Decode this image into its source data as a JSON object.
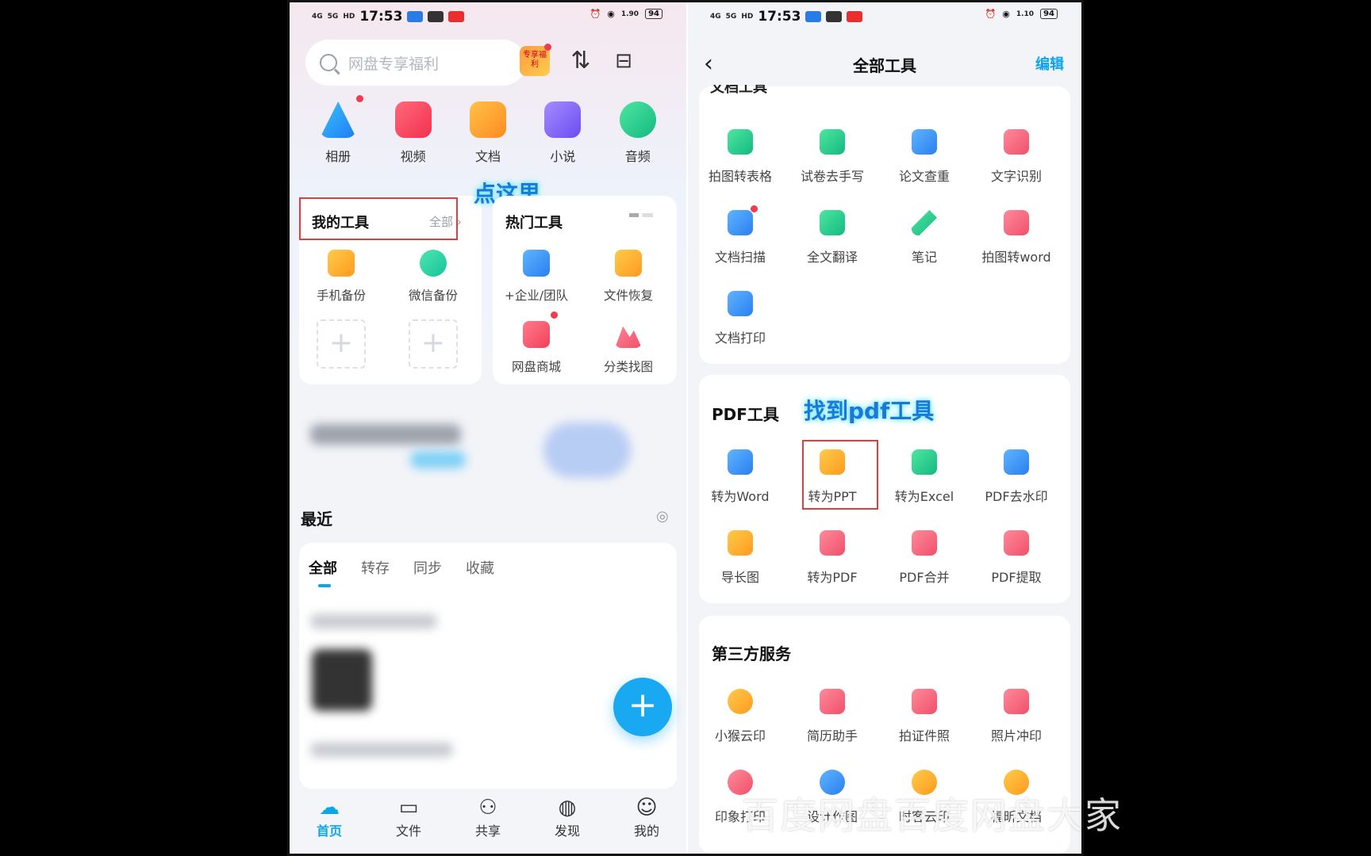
{
  "status_bar": {
    "time": "17:53",
    "net_left": "4G",
    "net_5g": "5G",
    "hd": "HD",
    "speed_left": "1.90",
    "speed_right": "1.10",
    "battery": "94"
  },
  "left": {
    "search_placeholder": "网盘专享福利",
    "gift_text": "专享福利",
    "categories": [
      "相册",
      "视频",
      "文档",
      "小说",
      "音频"
    ],
    "my_tools": {
      "title": "我的工具",
      "all": "全部",
      "items": [
        "手机备份",
        "微信备份"
      ],
      "add": "+"
    },
    "hot_tools": {
      "title": "热门工具",
      "items": [
        "+企业/团队",
        "文件恢复",
        "网盘商城",
        "分类找图"
      ]
    },
    "annotation": "点这里",
    "recent": {
      "title": "最近",
      "tabs": [
        "全部",
        "转存",
        "同步",
        "收藏"
      ]
    },
    "fab": "+",
    "nav": [
      "首页",
      "文件",
      "共享",
      "发现",
      "我的"
    ],
    "watermark": "百度网盘百度网盘大家"
  },
  "right": {
    "title": "全部工具",
    "edit": "编辑",
    "back": "‹",
    "cut_section": "文档工具",
    "doc_tools": [
      "拍图转表格",
      "试卷去手写",
      "论文查重",
      "文字识别",
      "文档扫描",
      "全文翻译",
      "笔记",
      "拍图转word",
      "文档打印"
    ],
    "pdf": {
      "title": "PDF工具",
      "annotation": "找到pdf工具",
      "items": [
        "转为Word",
        "转为PPT",
        "转为Excel",
        "PDF去水印",
        "导长图",
        "转为PDF",
        "PDF合并",
        "PDF提取"
      ]
    },
    "third": {
      "title": "第三方服务",
      "items": [
        "小猴云印",
        "简历助手",
        "拍证件照",
        "照片冲印",
        "印象打印",
        "设计作图",
        "时客云印",
        "福昕文档"
      ]
    }
  },
  "colors": {
    "accent": "#0ba5ec",
    "annotation_box": "#e23c3c"
  }
}
